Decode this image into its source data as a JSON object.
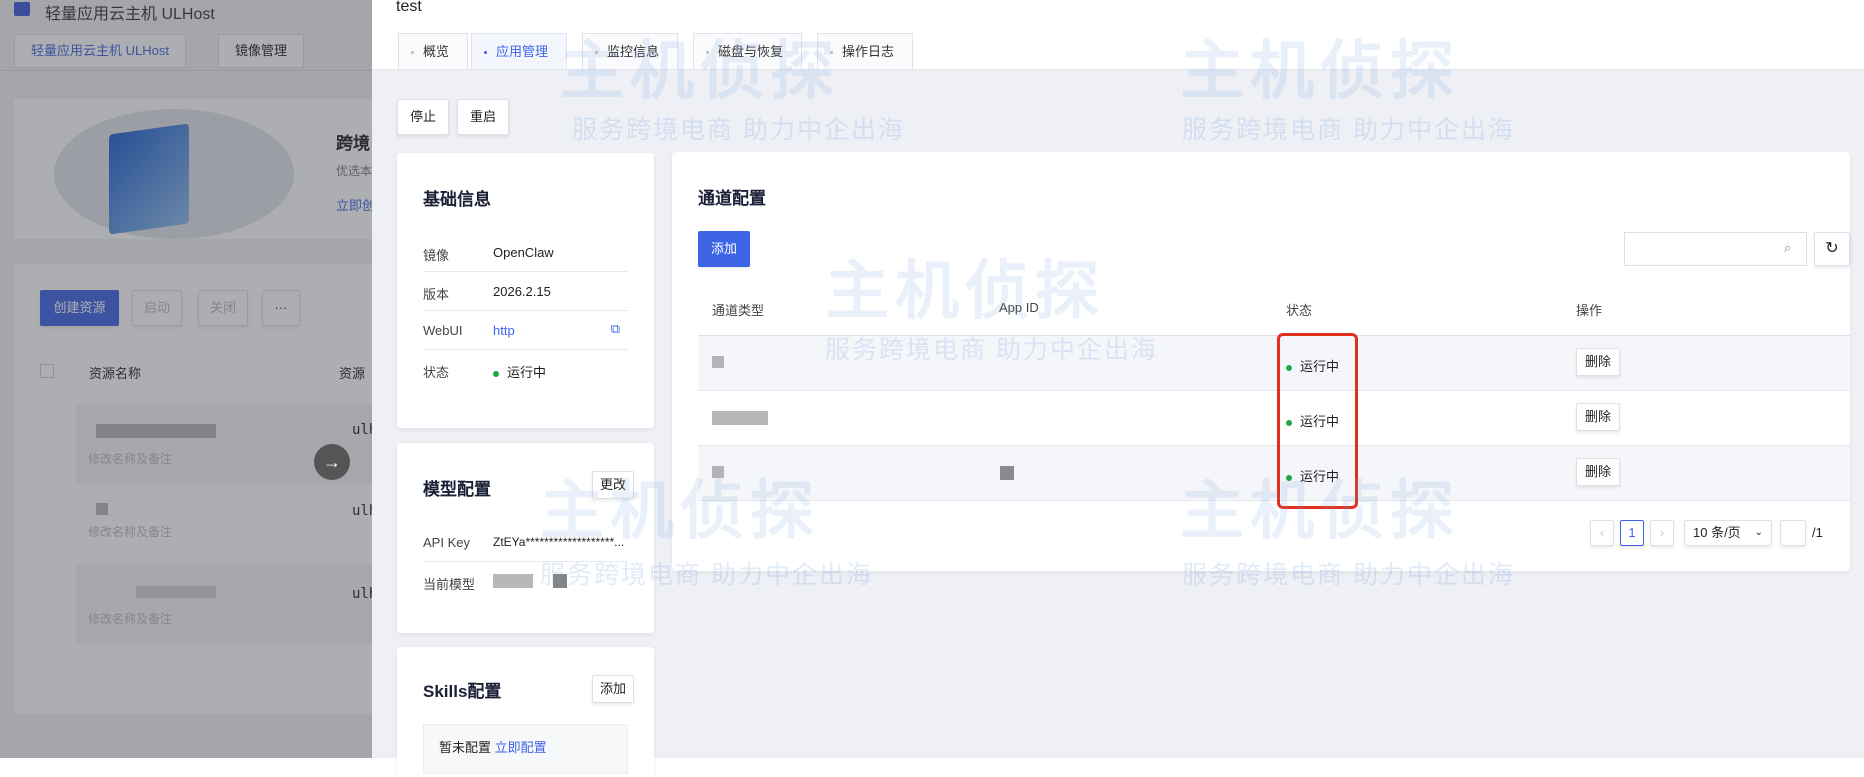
{
  "background_page": {
    "title": "轻量应用云主机 ULHost",
    "tabs": [
      "轻量应用云主机 ULHost",
      "镜像管理"
    ],
    "banner": {
      "heading": "跨境",
      "sub": "优选本",
      "link": "立即创"
    },
    "toolbar": {
      "create": "创建资源",
      "start": "启动",
      "stop": "关闭",
      "more": "···"
    },
    "table_headers": [
      "资源名称",
      "资源"
    ],
    "rows": [
      {
        "note": "修改名称及备注",
        "id": "ulho"
      },
      {
        "note": "修改名称及备注",
        "id": "ulho"
      },
      {
        "note": "修改名称及备注",
        "id": "ulho"
      }
    ]
  },
  "drawer": {
    "title": "test",
    "tabs": [
      {
        "label": "概览",
        "active": false
      },
      {
        "label": "应用管理",
        "active": true
      },
      {
        "label": "监控信息",
        "active": false
      },
      {
        "label": "磁盘与恢复",
        "active": false
      },
      {
        "label": "操作日志",
        "active": false
      }
    ],
    "actions": {
      "stop": "停止",
      "restart": "重启"
    },
    "basic_info": {
      "title": "基础信息",
      "image_label": "镜像",
      "image_value": "OpenClaw",
      "version_label": "版本",
      "version_value": "2026.2.15",
      "webui_label": "WebUI",
      "webui_value": "http",
      "status_label": "状态",
      "status_value": "运行中"
    },
    "model_config": {
      "title": "模型配置",
      "edit": "更改",
      "api_key_label": "API Key",
      "api_key_value": "ZtEYa*******************...",
      "model_label": "当前模型"
    },
    "skills_config": {
      "title": "Skills配置",
      "add": "添加",
      "empty": "暂未配置",
      "configure_link": "立即配置"
    },
    "channel_config": {
      "title": "通道配置",
      "add": "添加",
      "search_placeholder": "",
      "headers": [
        "通道类型",
        "App ID",
        "状态",
        "操作"
      ],
      "rows": [
        {
          "status": "运行中",
          "action": "删除"
        },
        {
          "status": "运行中",
          "action": "删除"
        },
        {
          "status": "运行中",
          "action": "删除"
        }
      ],
      "pagination": {
        "current": "1",
        "page_size": "10 条/页",
        "total": "/1"
      }
    }
  },
  "watermark": {
    "brand": "主机侦探",
    "slogan": "服务跨境电商 助力中企出海"
  },
  "colors": {
    "primary": "#3d63e6",
    "running": "#22a745",
    "highlight": "#e0301e"
  }
}
